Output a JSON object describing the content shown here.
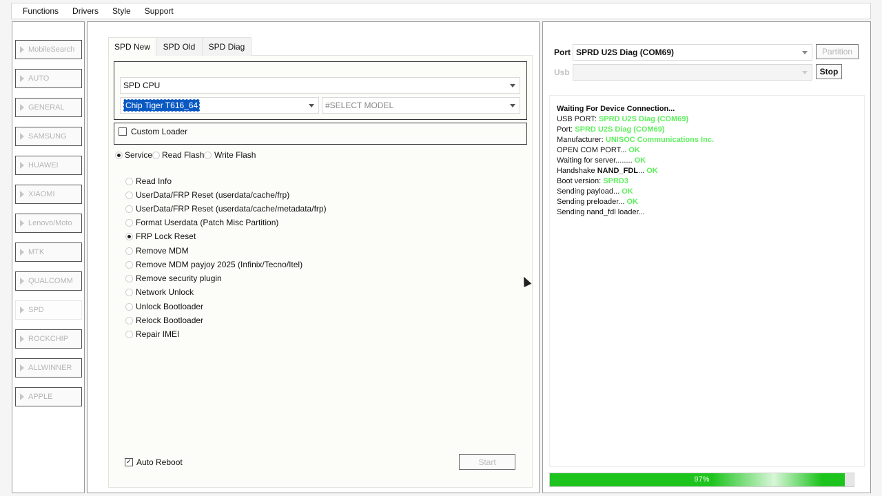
{
  "menu": [
    "Functions",
    "Drivers",
    "Style",
    "Support"
  ],
  "sidebar": {
    "items": [
      "MobileSearch",
      "AUTO",
      "GENERAL",
      "SAMSUNG",
      "HUAWEI",
      "XIAOMI",
      "Lenovo/Moto",
      "MTK",
      "QUALCOMM",
      "SPD",
      "ROCKCHIP",
      "ALLWINNER",
      "APPLE"
    ],
    "active": "SPD"
  },
  "tabs": [
    "SPD New",
    "SPD Old",
    "SPD Diag"
  ],
  "cpu": {
    "platform": "SPD CPU",
    "chip": "Chip Tiger T616_64",
    "model_placeholder": "#SELECT MODEL"
  },
  "custom_loader": "Custom Loader",
  "modes": [
    {
      "label": "Service",
      "checked": true
    },
    {
      "label": "Read  Flash",
      "checked": false
    },
    {
      "label": "Write Flash",
      "checked": false
    }
  ],
  "operations": [
    {
      "label": "Read Info",
      "checked": false
    },
    {
      "label": "UserData/FRP Reset (userdata/cache/frp)",
      "checked": false
    },
    {
      "label": "UserData/FRP Reset (userdata/cache/metadata/frp)",
      "checked": false
    },
    {
      "label": "Format Userdata (Patch Misc Partition)",
      "checked": false
    },
    {
      "label": "FRP Lock Reset",
      "checked": true
    },
    {
      "label": "Remove MDM",
      "checked": false
    },
    {
      "label": "Remove MDM payjoy 2025 (Infinix/Tecno/Itel)",
      "checked": false
    },
    {
      "label": "Remove security plugin",
      "checked": false
    },
    {
      "label": "Network Unlock",
      "checked": false
    },
    {
      "label": "Unlock Bootloader",
      "checked": false
    },
    {
      "label": "Relock Bootloader",
      "checked": false
    },
    {
      "label": "Repair IMEI",
      "checked": false
    }
  ],
  "auto_reboot": {
    "label": "Auto Reboot",
    "checked": true
  },
  "start_label": "Start",
  "right": {
    "port_label": "Port",
    "port_value": "SPRD U2S Diag (COM69)",
    "partition_label": "Partition",
    "usb_label": "Usb",
    "stop_label": "Stop"
  },
  "log": [
    [
      {
        "t": "Waiting For Device Connection...",
        "s": "b"
      }
    ],
    [
      {
        "t": "USB PORT: ",
        "s": ""
      },
      {
        "t": "SPRD U2S Diag (COM69)",
        "s": "g"
      }
    ],
    [
      {
        "t": "Port: ",
        "s": ""
      },
      {
        "t": "SPRD U2S Diag (COM69)",
        "s": "g"
      }
    ],
    [
      {
        "t": "Manufacturer: ",
        "s": ""
      },
      {
        "t": "UNISOC Communications Inc.",
        "s": "g"
      }
    ],
    [
      {
        "t": "OPEN COM PORT... ",
        "s": ""
      },
      {
        "t": "OK",
        "s": "g"
      }
    ],
    [
      {
        "t": "Waiting for server........ ",
        "s": ""
      },
      {
        "t": "OK",
        "s": "g"
      }
    ],
    [
      {
        "t": "Handshake ",
        "s": ""
      },
      {
        "t": "NAND_FDL",
        "s": "b"
      },
      {
        "t": "... ",
        "s": ""
      },
      {
        "t": "OK",
        "s": "g"
      }
    ],
    [
      {
        "t": "Boot version: ",
        "s": ""
      },
      {
        "t": "SPRD3",
        "s": "g"
      }
    ],
    [
      {
        "t": "Sending payload... ",
        "s": ""
      },
      {
        "t": "OK",
        "s": "g"
      }
    ],
    [
      {
        "t": "Sending preloader... ",
        "s": ""
      },
      {
        "t": "OK",
        "s": "g"
      }
    ],
    [
      {
        "t": "Sending nand_fdl loader...",
        "s": ""
      }
    ]
  ],
  "progress": {
    "percent": 97,
    "label": "97%"
  },
  "colors": {
    "ok_green": "#5ef05e",
    "progress_green": "#1ec41e",
    "selection_blue": "#0a59c3"
  }
}
